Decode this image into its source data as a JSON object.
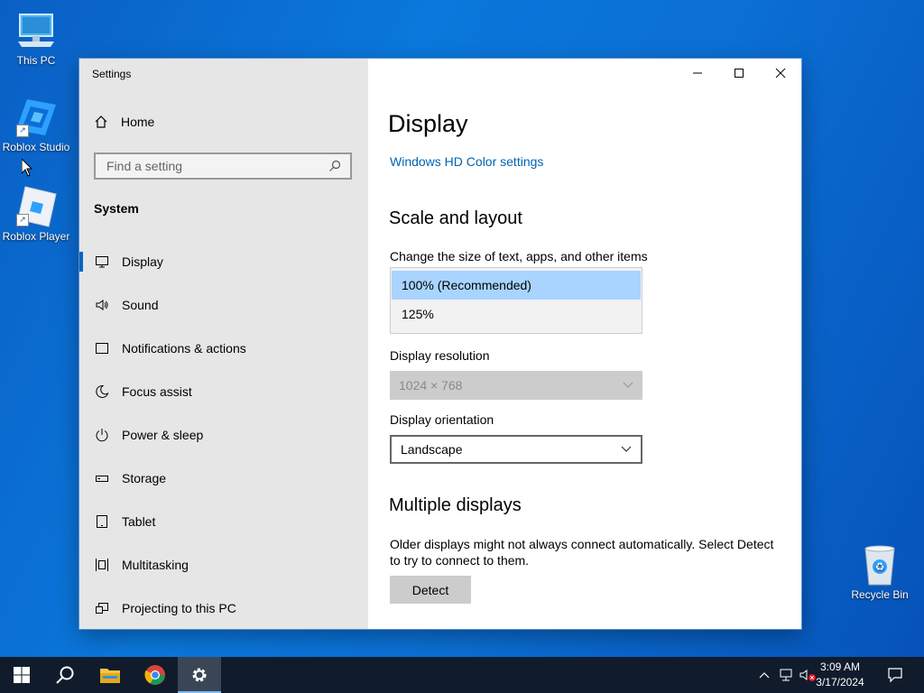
{
  "desktop": {
    "icons": [
      {
        "label": "This PC",
        "icon": "computer-icon"
      },
      {
        "label": "Roblox Studio",
        "icon": "roblox-studio-icon"
      },
      {
        "label": "Roblox Player",
        "icon": "roblox-player-icon"
      },
      {
        "label": "Recycle Bin",
        "icon": "recycle-bin-icon"
      }
    ]
  },
  "window": {
    "title": "Settings",
    "controls": {
      "minimize": "minimize-icon",
      "maximize": "maximize-icon",
      "close": "close-icon"
    }
  },
  "sidebar": {
    "home_label": "Home",
    "search_placeholder": "Find a setting",
    "section": "System",
    "items": [
      {
        "label": "Display",
        "icon": "monitor-icon",
        "active": true
      },
      {
        "label": "Sound",
        "icon": "speaker-icon"
      },
      {
        "label": "Notifications & actions",
        "icon": "notification-icon"
      },
      {
        "label": "Focus assist",
        "icon": "moon-icon"
      },
      {
        "label": "Power & sleep",
        "icon": "power-icon"
      },
      {
        "label": "Storage",
        "icon": "storage-icon"
      },
      {
        "label": "Tablet",
        "icon": "tablet-icon"
      },
      {
        "label": "Multitasking",
        "icon": "multitasking-icon"
      },
      {
        "label": "Projecting to this PC",
        "icon": "projecting-icon"
      }
    ]
  },
  "content": {
    "title": "Display",
    "hd_link": "Windows HD Color settings",
    "scale_heading": "Scale and layout",
    "scale_label": "Change the size of text, apps, and other items",
    "scale_options": [
      {
        "label": "100% (Recommended)",
        "selected": true
      },
      {
        "label": "125%",
        "selected": false
      }
    ],
    "resolution_label": "Display resolution",
    "resolution_value": "1024 × 768",
    "orientation_label": "Display orientation",
    "orientation_value": "Landscape",
    "multiple_heading": "Multiple displays",
    "multiple_text": "Older displays might not always connect automatically. Select Detect to try to connect to them.",
    "detect_button": "Detect"
  },
  "taskbar": {
    "time": "3:09 AM",
    "date": "3/17/2024",
    "apps": [
      "start-icon",
      "search-icon",
      "file-explorer-icon",
      "chrome-icon",
      "settings-icon"
    ],
    "accent": "#0078d7"
  }
}
